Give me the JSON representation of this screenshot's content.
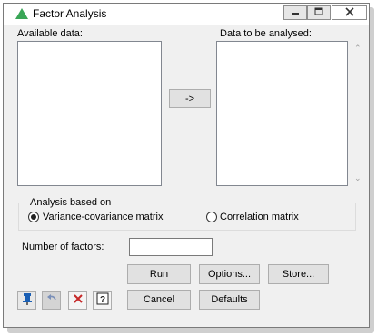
{
  "window": {
    "title": "Factor Analysis"
  },
  "available_data": {
    "label": "Available data:"
  },
  "data_to_analyse": {
    "label": "Data to be analysed:"
  },
  "transfer_button": {
    "label": "->"
  },
  "analysis_based_on": {
    "legend": "Analysis based on",
    "options": [
      {
        "label": "Variance-covariance matrix",
        "selected": true
      },
      {
        "label": "Correlation matrix",
        "selected": false
      }
    ]
  },
  "number_of_factors": {
    "label": "Number of factors:",
    "value": ""
  },
  "buttons": {
    "run": "Run",
    "options": "Options...",
    "store": "Store...",
    "cancel": "Cancel",
    "defaults": "Defaults"
  },
  "toolbar": {
    "icons": [
      "pin-icon",
      "undo-icon",
      "clear-icon",
      "help-icon"
    ]
  },
  "colors": {
    "accent_green": "#3aa657",
    "clear_red": "#c62828"
  }
}
